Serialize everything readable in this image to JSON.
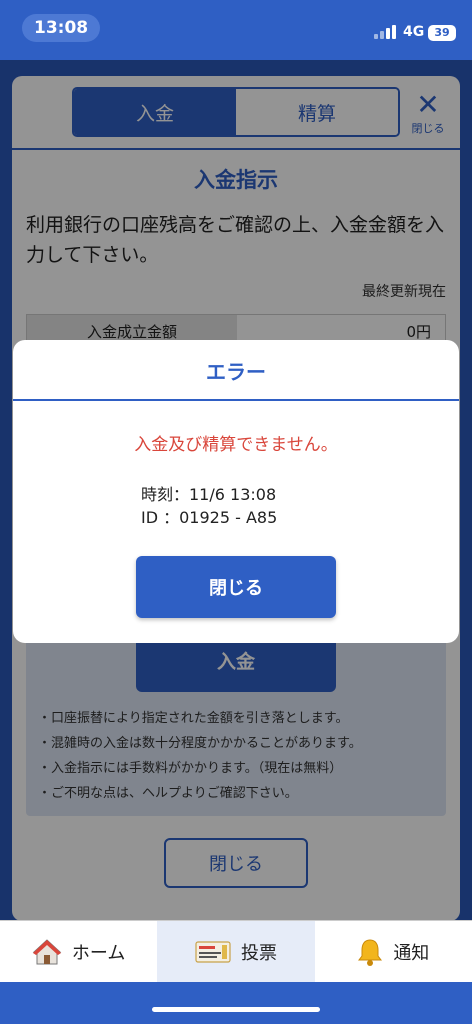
{
  "status_bar": {
    "time": "13:08",
    "network": "4G",
    "battery": "39"
  },
  "panel": {
    "tabs": [
      {
        "label": "入金"
      },
      {
        "label": "精算"
      }
    ],
    "close_icon_label": "閉じる",
    "title": "入金指示",
    "description": "利用銀行の口座残高をご確認の上、入金金額を入力して下さい。",
    "last_updated": "最終更新現在",
    "amount_label": "入金成立金額",
    "amount_value": "0円",
    "deposit_button": "入金",
    "notes": [
      "口座振替により指定された金額を引き落とします。",
      "混雑時の入金は数十分程度かかかることがあります。",
      "入金指示には手数料がかかります。（現在は無料）",
      "ご不明な点は、ヘルプよりご確認下さい。"
    ],
    "close_button": "閉じる"
  },
  "modal": {
    "title": "エラー",
    "message": "入金及び精算できません。",
    "time_line": "時刻：11/6 13:08",
    "id_line": "ID ：01925 - A85",
    "close_button": "閉じる"
  },
  "bottom_nav": {
    "items": [
      {
        "label": "ホーム",
        "icon": "home-icon"
      },
      {
        "label": "投票",
        "icon": "ticket-icon"
      },
      {
        "label": "通知",
        "icon": "bell-icon"
      }
    ]
  },
  "colors": {
    "accent": "#2f5fc4",
    "error": "#d9463b"
  }
}
